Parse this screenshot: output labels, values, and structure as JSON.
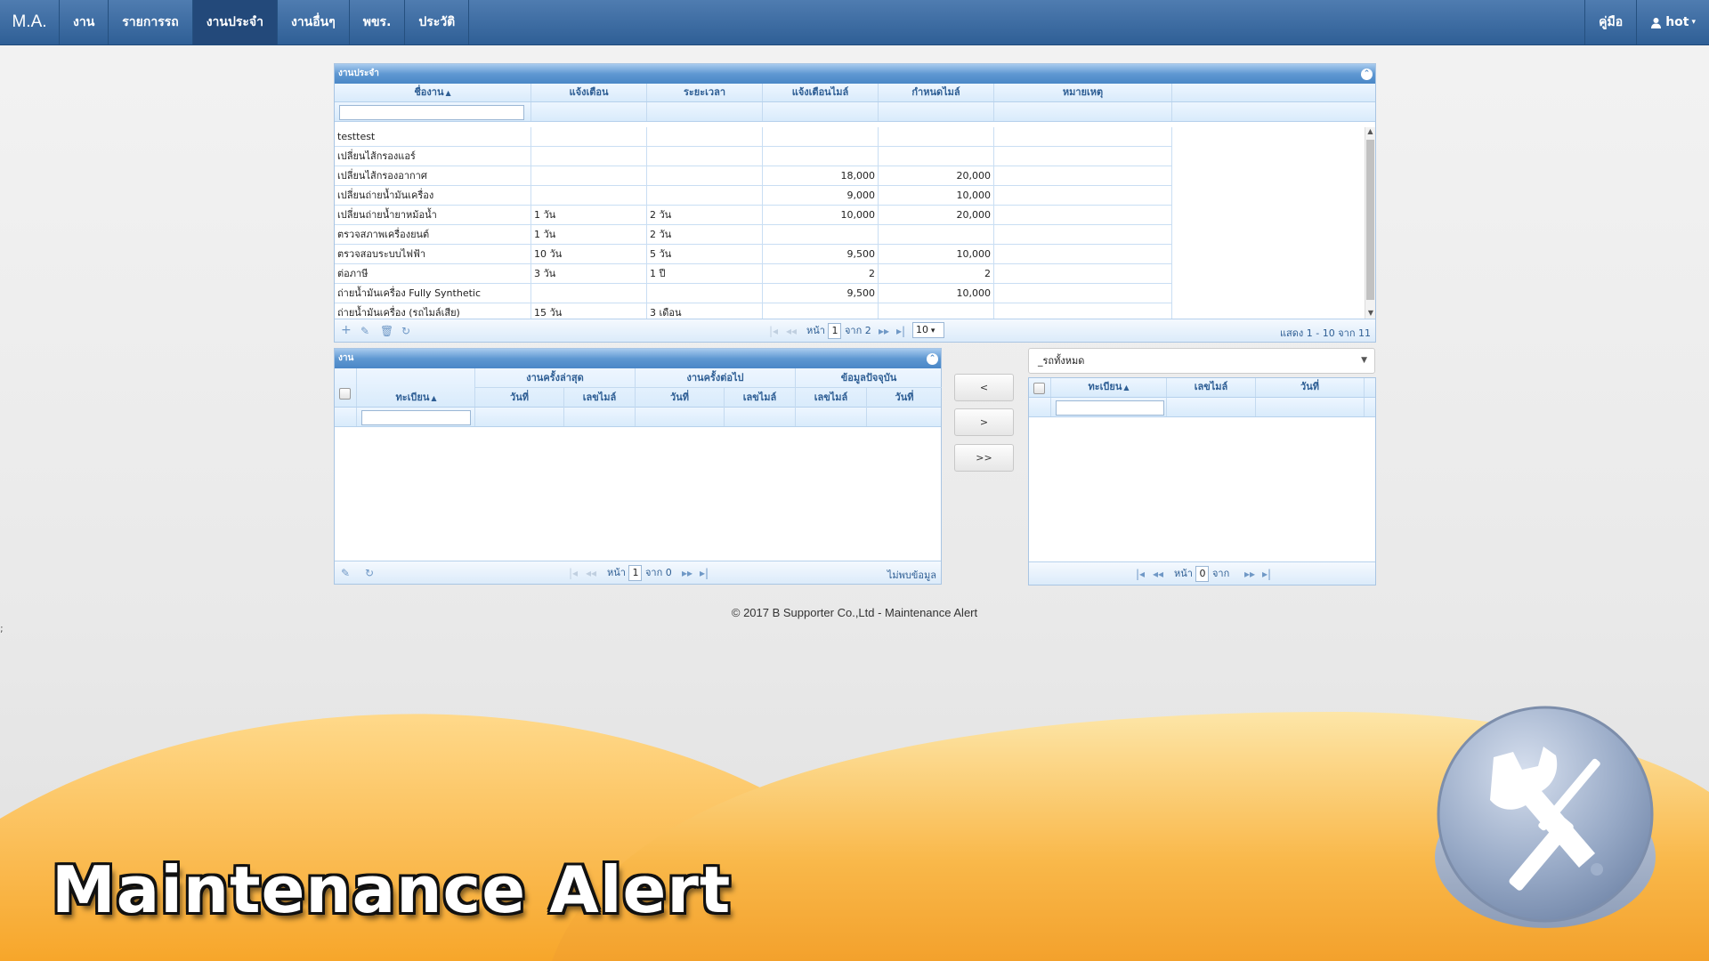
{
  "nav": {
    "brand": "M.A.",
    "items": [
      "งาน",
      "รายการรถ",
      "งานประจำ",
      "งานอื่นๆ",
      "พขร.",
      "ประวัติ"
    ],
    "manual": "คู่มือ",
    "user": "hot"
  },
  "top_grid": {
    "caption": "งานประจำ",
    "headers": [
      "ชื่องาน",
      "แจ้งเตือน",
      "ระยะเวลา",
      "แจ้งเตือนไมล์",
      "กำหนดไมล์",
      "หมายเหตุ"
    ],
    "rows": [
      [
        "testtest",
        "",
        "",
        "",
        "",
        ""
      ],
      [
        "เปลี่ยนไส้กรองแอร์",
        "",
        "",
        "",
        "",
        ""
      ],
      [
        "เปลี่ยนไส้กรองอากาศ",
        "",
        "",
        "18,000",
        "20,000",
        ""
      ],
      [
        "เปลี่ยนถ่ายน้ำมันเครื่อง",
        "",
        "",
        "9,000",
        "10,000",
        ""
      ],
      [
        "เปลี่ยนถ่ายน้ำยาหม้อน้ำ",
        "1 วัน",
        "2 วัน",
        "10,000",
        "20,000",
        ""
      ],
      [
        "ตรวจสภาพเครื่องยนต์",
        "1 วัน",
        "2 วัน",
        "",
        "",
        ""
      ],
      [
        "ตรวจสอบระบบไฟฟ้า",
        "10 วัน",
        "5 วัน",
        "9,500",
        "10,000",
        ""
      ],
      [
        "ต่อภาษี",
        "3 วัน",
        "1 ปี",
        "2",
        "2",
        ""
      ],
      [
        "ถ่ายน้ำมันเครื่อง Fully Synthetic",
        "",
        "",
        "9,500",
        "10,000",
        ""
      ],
      [
        "ถ่ายน้ำมันเครื่อง (รถไมล์เสีย)",
        "15 วัน",
        "3 เดือน",
        "",
        "",
        ""
      ]
    ],
    "pager": {
      "page_label": "หน้า",
      "page": "1",
      "of_label": "จาก 2",
      "rows_per_page": "10",
      "info": "แสดง 1 - 10 จาก 11"
    }
  },
  "job_grid": {
    "caption": "งาน",
    "groups": [
      "งานครั้งล่าสุด",
      "งานครั้งต่อไป",
      "ข้อมูลปัจจุบัน"
    ],
    "headers": [
      "ทะเบียน",
      "วันที่",
      "เลขไมล์",
      "วันที่",
      "เลขไมล์",
      "เลขไมล์",
      "วันที่"
    ],
    "pager": {
      "page_label": "หน้า",
      "page": "1",
      "of_label": "จาก 0",
      "info": "ไม่พบข้อมูล"
    }
  },
  "move_buttons": [
    "<",
    ">",
    ">>"
  ],
  "car_select": {
    "value": "_รถทั้งหมด"
  },
  "car_grid": {
    "headers": [
      "ทะเบียน",
      "เลขไมล์",
      "วันที่"
    ],
    "pager": {
      "page_label": "หน้า",
      "page": "0",
      "of_label": "จาก"
    }
  },
  "footer": "© 2017 B Supporter Co.,Ltd - Maintenance Alert",
  "stray_mark": ";",
  "banner": {
    "title": "Maintenance Alert"
  },
  "icons": {
    "sort": "sort-asc-icon",
    "add": "plus-icon",
    "edit": "pencil-icon",
    "delete": "trash-icon",
    "refresh": "refresh-icon",
    "user": "user-icon",
    "logo": "wrench-screwdriver-icon"
  },
  "colors": {
    "nav": "#2f5f96",
    "grid_header": "#4a87c7",
    "accent_orange": "#f7b043"
  }
}
